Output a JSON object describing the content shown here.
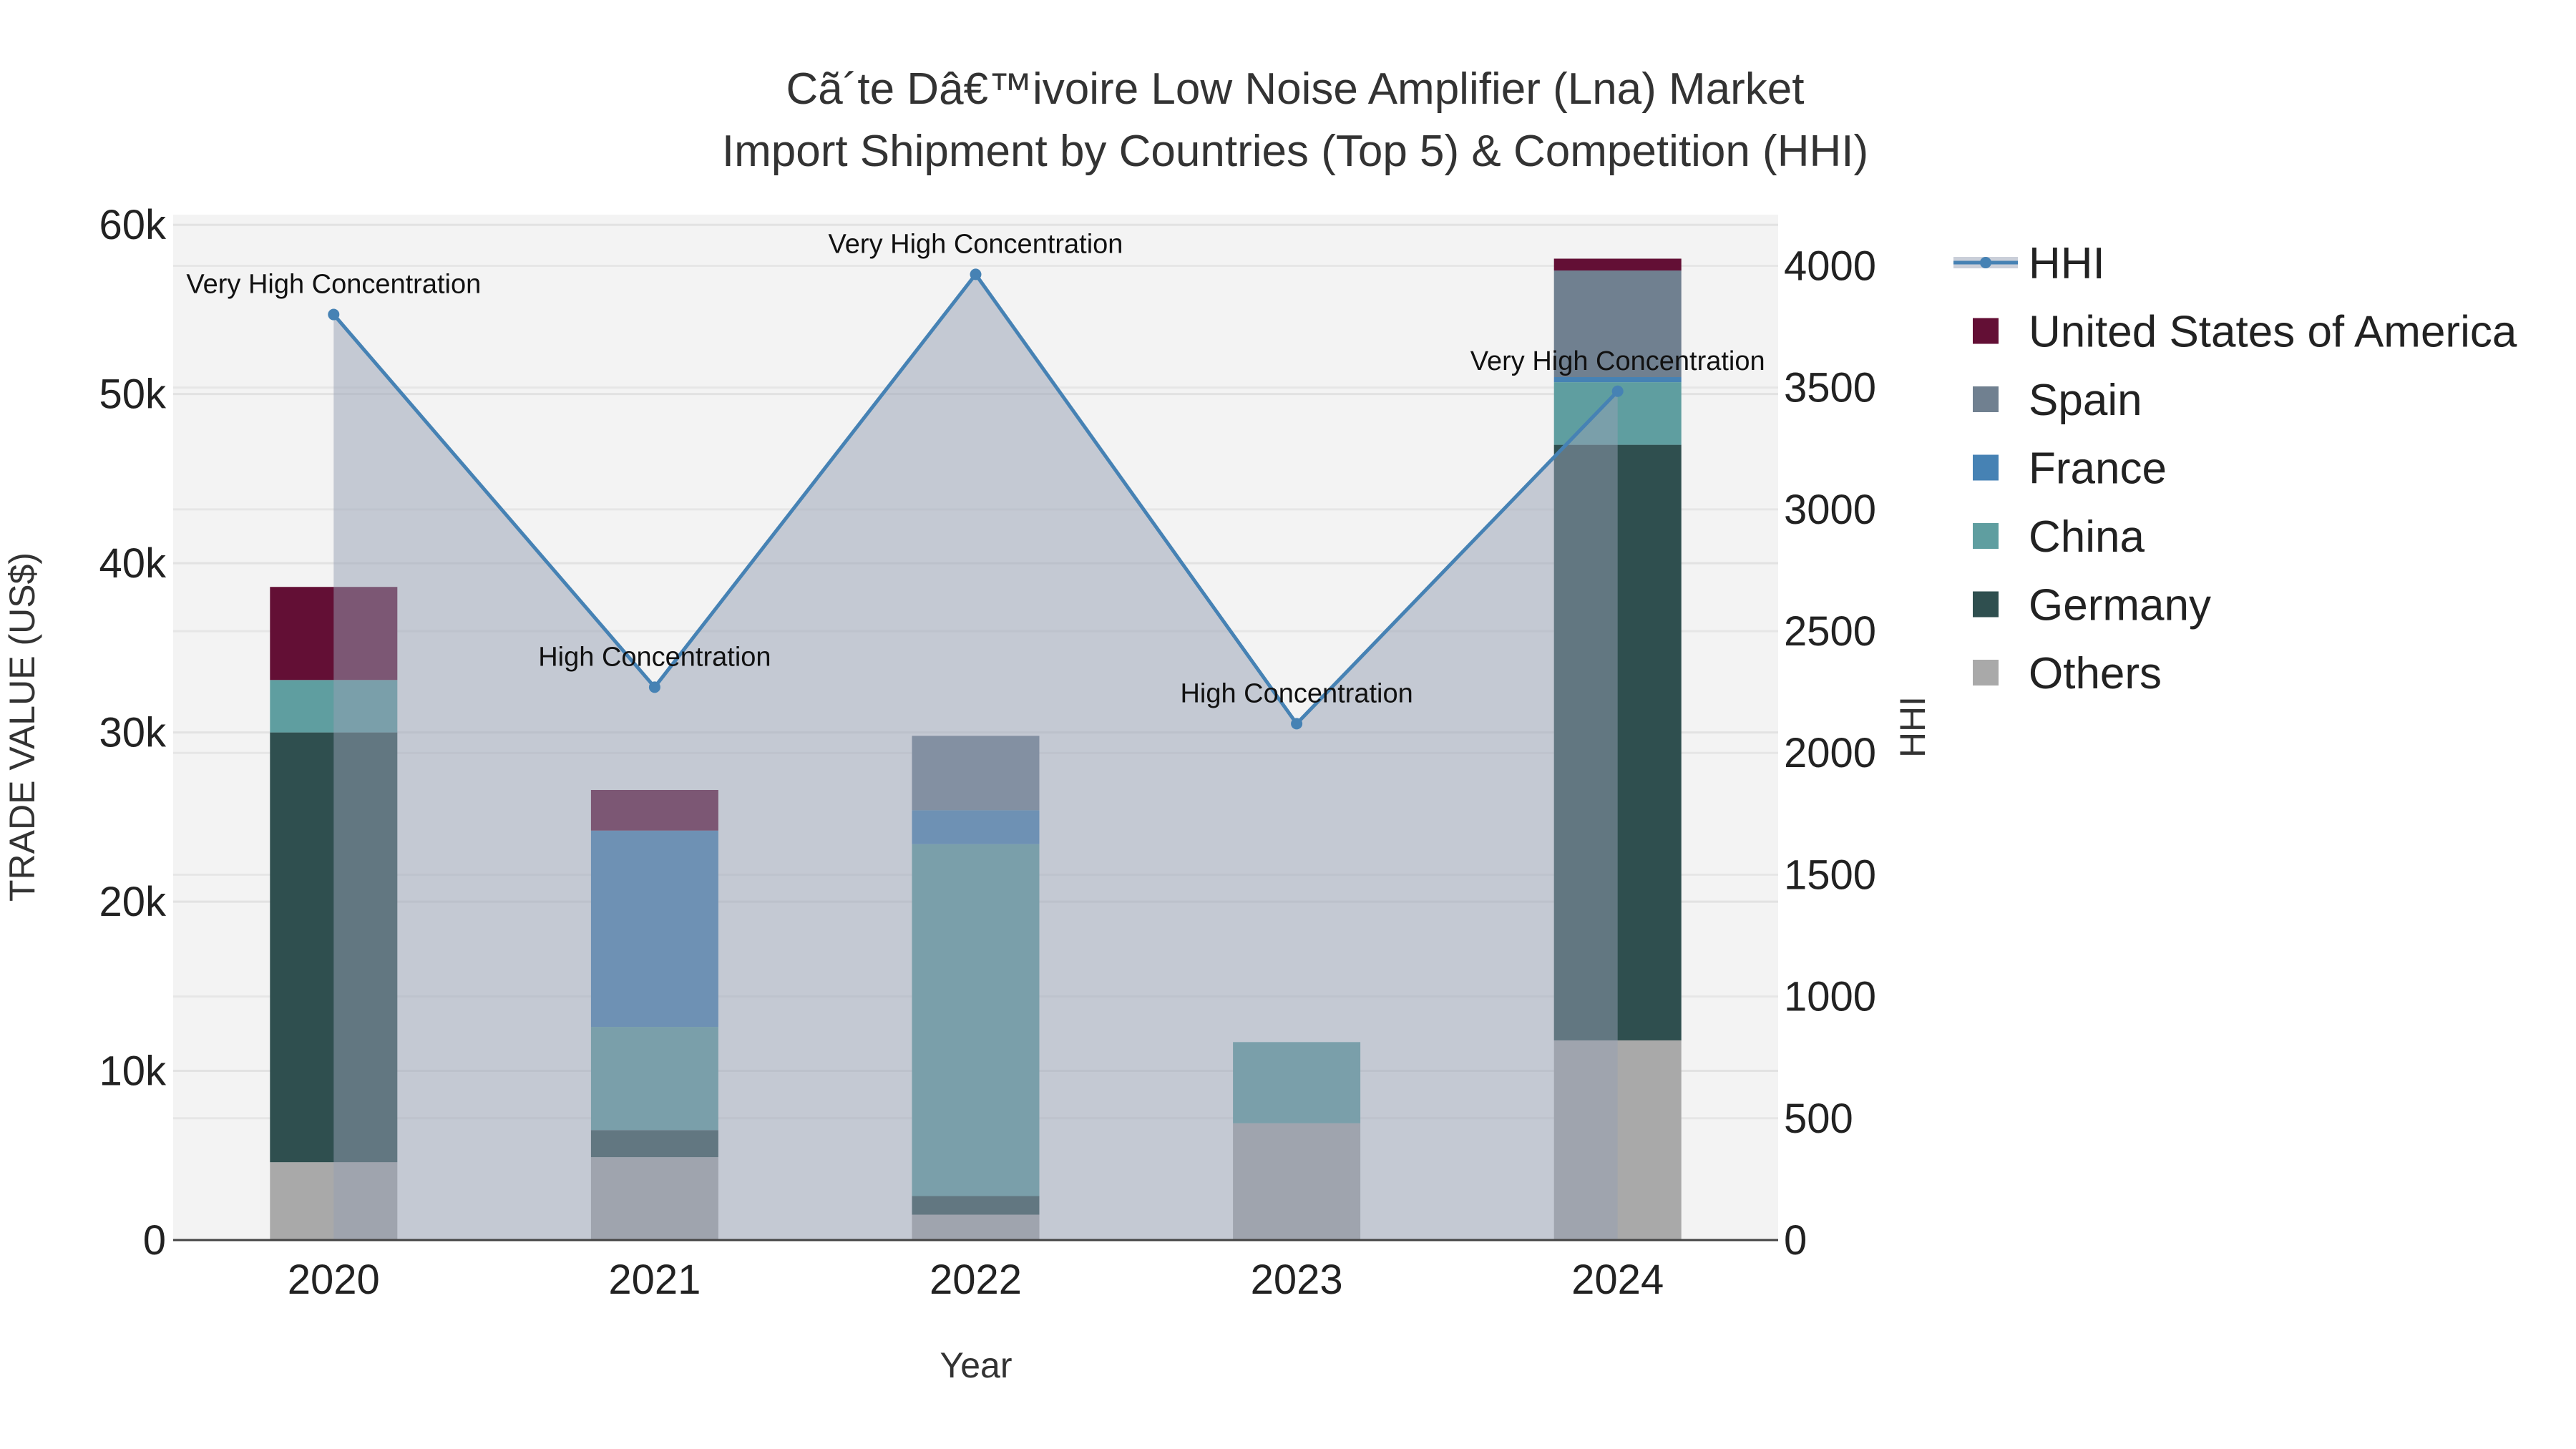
{
  "chart_data": {
    "type": "bar",
    "title": "Cã´te Dâ€™ivoire Low Noise Amplifier (Lna) Market",
    "subtitle": "Import Shipment by Countries (Top 5) & Competition (HHI)",
    "xlabel": "Year",
    "ylabel": "TRADE VALUE (US$)",
    "y2label": "HHI",
    "categories": [
      "2020",
      "2021",
      "2022",
      "2023",
      "2024"
    ],
    "ylim": [
      0,
      60600
    ],
    "y2lim": [
      0,
      4210
    ],
    "yticks": [
      0,
      10000,
      20000,
      30000,
      40000,
      50000,
      60000
    ],
    "ytick_labels": [
      "0",
      "10k",
      "20k",
      "30k",
      "40k",
      "50k",
      "60k"
    ],
    "y2ticks": [
      0,
      500,
      1000,
      1500,
      2000,
      2500,
      3000,
      3500,
      4000
    ],
    "y2tick_labels": [
      "0",
      "500",
      "1000",
      "1500",
      "2000",
      "2500",
      "3000",
      "3500",
      "4000"
    ],
    "grid": true,
    "legend_placement": "right",
    "series": [
      {
        "name": "Others",
        "color": "#a9a9a9",
        "values": [
          4600,
          4900,
          1500,
          6900,
          11800
        ]
      },
      {
        "name": "Germany",
        "color": "#2f4f4f",
        "values": [
          25400,
          1600,
          1100,
          0,
          35200
        ]
      },
      {
        "name": "China",
        "color": "#5f9ea0",
        "values": [
          3100,
          6100,
          20800,
          4800,
          3700
        ]
      },
      {
        "name": "France",
        "color": "#4682b4",
        "values": [
          0,
          11600,
          2000,
          0,
          300
        ]
      },
      {
        "name": "Spain",
        "color": "#708090",
        "values": [
          0,
          0,
          4400,
          0,
          6300
        ]
      },
      {
        "name": "United States of America",
        "color": "#630f35",
        "values": [
          5500,
          2400,
          0,
          0,
          700
        ]
      }
    ],
    "line": {
      "name": "HHI",
      "color": "#4682b4",
      "values": [
        3800,
        2270,
        3965,
        2120,
        3485
      ],
      "annotations": [
        "Very High Concentration",
        "High Concentration",
        "Very High Concentration",
        "High Concentration",
        "Very High Concentration"
      ]
    },
    "legend_order": [
      "HHI",
      "United States of America",
      "Spain",
      "France",
      "China",
      "Germany",
      "Others"
    ]
  }
}
